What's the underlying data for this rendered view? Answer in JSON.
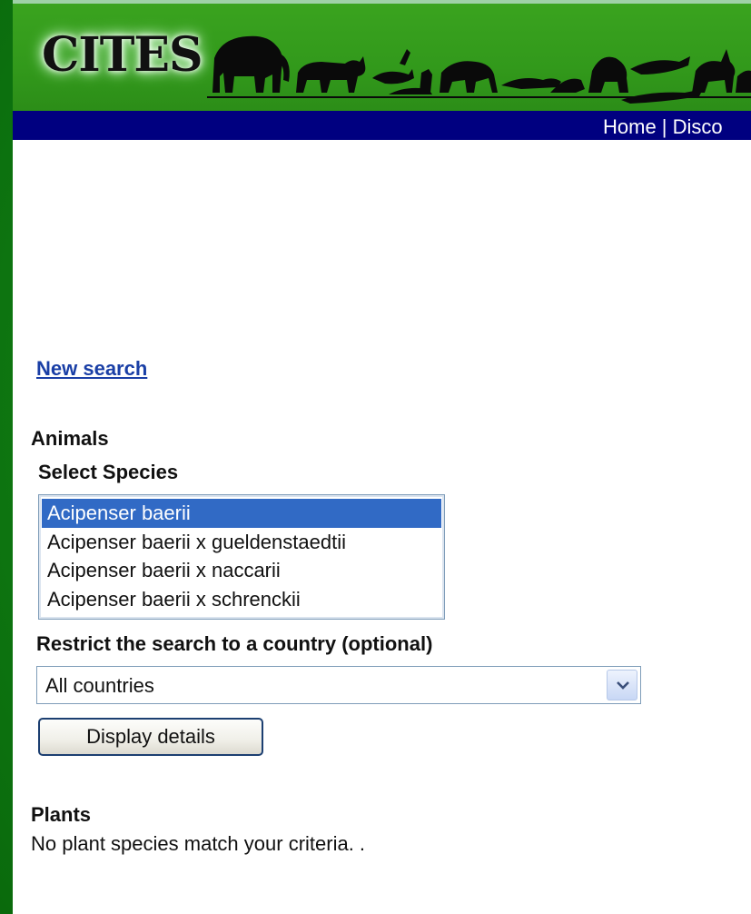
{
  "header": {
    "logo_text": "CITES",
    "nav_text": "Home | Disco"
  },
  "links": {
    "new_search": "New search"
  },
  "animals": {
    "heading": "Animals",
    "select_label": "Select Species",
    "species_options": [
      "Acipenser baerii",
      "Acipenser baerii x gueldenstaedtii",
      "Acipenser baerii x naccarii",
      "Acipenser baerii x schrenckii"
    ],
    "selected_index": 0,
    "restrict_label": "Restrict the search to a country (optional)",
    "country_value": "All countries",
    "display_button": "Display details"
  },
  "plants": {
    "heading": "Plants",
    "message": "No plant species match your criteria. ."
  },
  "colors": {
    "banner_green": "#32991b",
    "nav_blue": "#000080",
    "selection_blue": "#316ac5",
    "link_blue": "#1a3fa6"
  }
}
